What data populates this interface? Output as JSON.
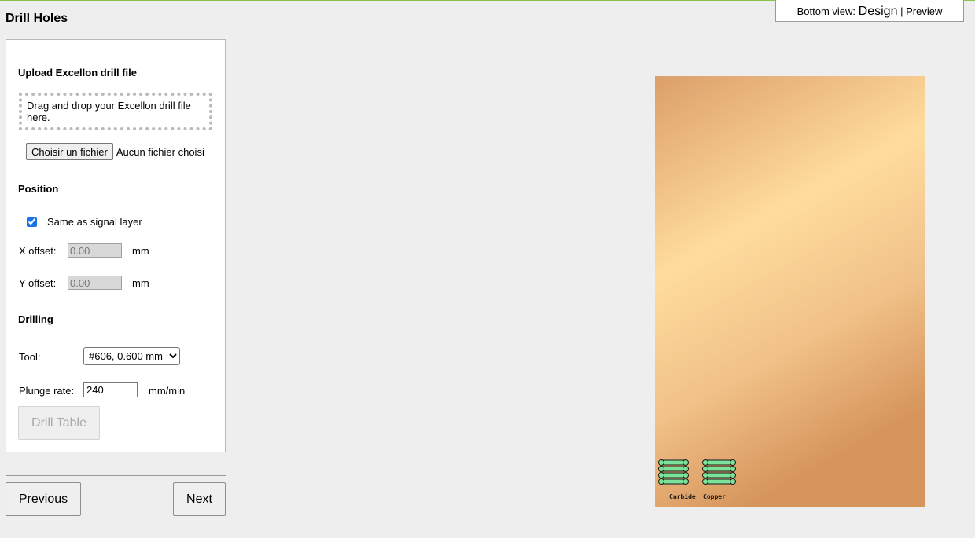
{
  "page": {
    "title": "Drill Holes"
  },
  "view_toggle": {
    "prefix": "Bottom view:",
    "active": "Design",
    "separator": "|",
    "link": "Preview"
  },
  "upload": {
    "title": "Upload Excellon drill file",
    "dropzone_text": "Drag and drop your Excellon drill file here.",
    "choose_button": "Choisir un fichier",
    "file_status": "Aucun fichier choisi"
  },
  "position": {
    "title": "Position",
    "same_as_signal_label": "Same as signal layer",
    "same_as_signal_checked": true,
    "x_offset_label": "X offset:",
    "x_offset_value": "0.00",
    "y_offset_label": "Y offset:",
    "y_offset_value": "0.00",
    "unit": "mm"
  },
  "drilling": {
    "title": "Drilling",
    "tool_label": "Tool:",
    "tool_selected": "#606, 0.600 mm",
    "plunge_label": "Plunge rate:",
    "plunge_value": "240",
    "plunge_unit": "mm/min",
    "drill_table_button": "Drill Table"
  },
  "nav": {
    "previous": "Previous",
    "next": "Next"
  },
  "board": {
    "labels": [
      "Carbide",
      "Copper"
    ],
    "colors": {
      "copper_light": "#ffdc9e",
      "copper_mid": "#e8b47a",
      "copper_dark": "#d6995e",
      "trace": "#7be29a"
    }
  }
}
